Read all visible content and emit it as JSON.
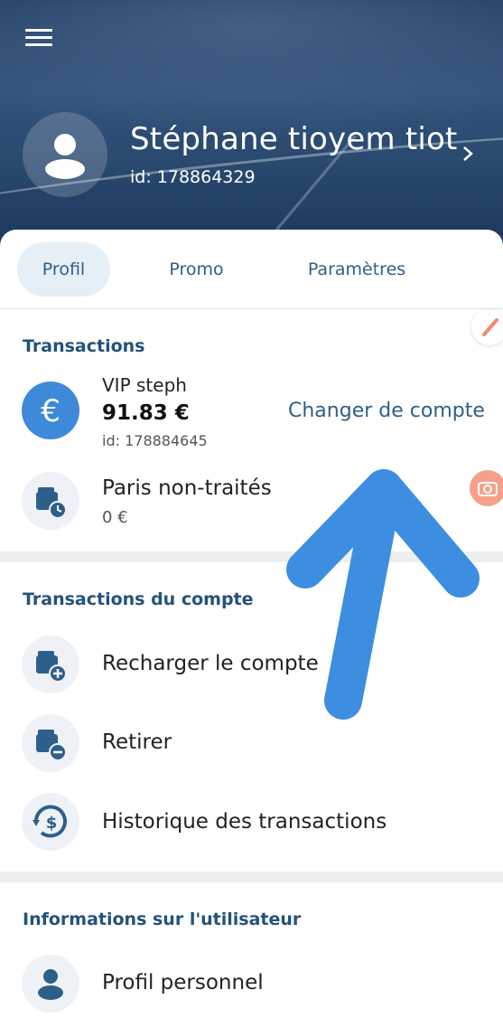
{
  "header": {
    "user_name": "Stéphane tioyem tiot",
    "user_id": "id: 178864329"
  },
  "tabs": [
    {
      "label": "Profil",
      "active": true
    },
    {
      "label": "Promo",
      "active": false
    },
    {
      "label": "Paramètres",
      "active": false
    }
  ],
  "transactions": {
    "title": "Transactions",
    "account": {
      "name": "VIP steph",
      "balance": "91.83 €",
      "id": "id: 178884645",
      "change_label": "Changer de compte"
    },
    "pending_bets": {
      "label": "Paris non-traités",
      "value": "0 €"
    }
  },
  "account_transactions": {
    "title": "Transactions du compte",
    "items": [
      {
        "label": "Recharger le compte",
        "icon": "wallet-plus-icon"
      },
      {
        "label": "Retirer",
        "icon": "wallet-minus-icon"
      },
      {
        "label": "Historique des transactions",
        "icon": "history-dollar-icon"
      }
    ]
  },
  "user_info": {
    "title": "Informations sur l'utilisateur",
    "items": [
      {
        "label": "Profil personnel",
        "icon": "user-icon"
      }
    ]
  },
  "colors": {
    "accent": "#2e5f8a",
    "icon_blue": "#3e8ad8",
    "annotation_arrow": "#3d8ee0"
  }
}
